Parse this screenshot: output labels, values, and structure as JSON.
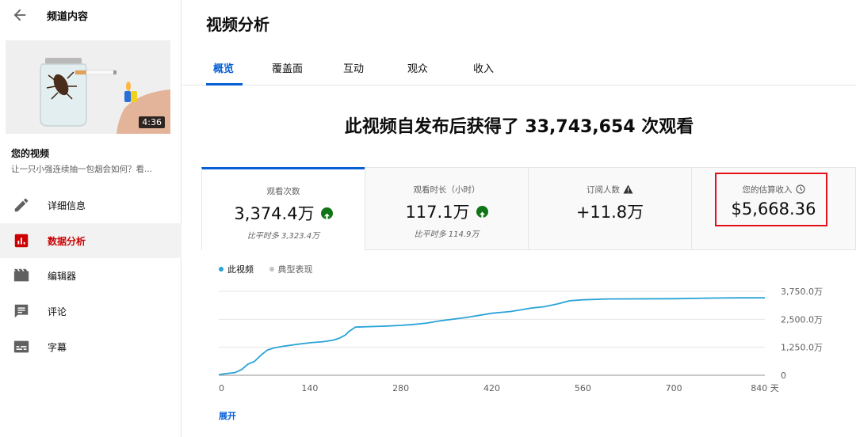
{
  "sidebar": {
    "title": "频道内容",
    "thumb_duration": "4:36",
    "your_video_label": "您的视频",
    "video_title": "让一只小强连续抽一包烟会如何？看...",
    "items": [
      {
        "label": "详细信息",
        "icon": "pencil-icon"
      },
      {
        "label": "数据分析",
        "icon": "analytics-icon"
      },
      {
        "label": "编辑器",
        "icon": "film-icon"
      },
      {
        "label": "评论",
        "icon": "comment-icon"
      },
      {
        "label": "字幕",
        "icon": "subtitles-icon"
      }
    ],
    "active_index": 1
  },
  "main": {
    "title": "视频分析",
    "tabs": [
      "概览",
      "覆盖面",
      "互动",
      "观众",
      "收入"
    ],
    "active_tab": 0,
    "headline": "此视频自发布后获得了 33,743,654 次观看",
    "cards": [
      {
        "label": "观看次数",
        "value": "3,374.4万",
        "note": "比平时多 3,323.4万",
        "trend": "up"
      },
      {
        "label": "观看时长（小时）",
        "value": "117.1万",
        "note": "比平时多 114.9万",
        "trend": "up"
      },
      {
        "label": "订阅人数",
        "value": "+11.8万",
        "note": "",
        "trend": "warning"
      },
      {
        "label": "您的估算收入",
        "value": "$5,668.36",
        "note": "",
        "trend": "info"
      }
    ],
    "legend": {
      "this_video": "此视频",
      "typical": "典型表现"
    },
    "expand_label": "展开"
  },
  "colors": {
    "accent": "#065fd4",
    "line": "#2ba3d8",
    "positive": "#107516",
    "highlight": "#e3101a",
    "active_nav": "#cc0000"
  },
  "chart_data": {
    "type": "line",
    "series": [
      {
        "name": "此视频",
        "x": [
          0,
          10,
          25,
          35,
          45,
          55,
          65,
          75,
          85,
          100,
          120,
          140,
          160,
          175,
          185,
          195,
          200,
          205,
          210,
          240,
          260,
          280,
          300,
          320,
          340,
          380,
          420,
          450,
          480,
          500,
          520,
          540,
          560,
          600,
          700,
          760,
          800,
          840
        ],
        "y": [
          20,
          70,
          120,
          250,
          500,
          620,
          900,
          1130,
          1220,
          1300,
          1380,
          1450,
          1500,
          1560,
          1650,
          1800,
          1950,
          2050,
          2150,
          2180,
          2200,
          2230,
          2270,
          2330,
          2430,
          2580,
          2770,
          2850,
          3000,
          3060,
          3180,
          3330,
          3370,
          3410,
          3420,
          3450,
          3460,
          3460
        ]
      }
    ],
    "xticks": [
      "0",
      "140",
      "280",
      "420",
      "560",
      "700",
      "840 天"
    ],
    "xtick_values": [
      0,
      140,
      280,
      420,
      560,
      700,
      840
    ],
    "yticks": [
      "0",
      "1,250.0万",
      "2,500.0万",
      "3,750.0万"
    ],
    "ytick_values": [
      0,
      1250,
      2500,
      3750
    ],
    "xlim": [
      0,
      840
    ],
    "ylim": [
      0,
      3750
    ],
    "grid": true
  }
}
